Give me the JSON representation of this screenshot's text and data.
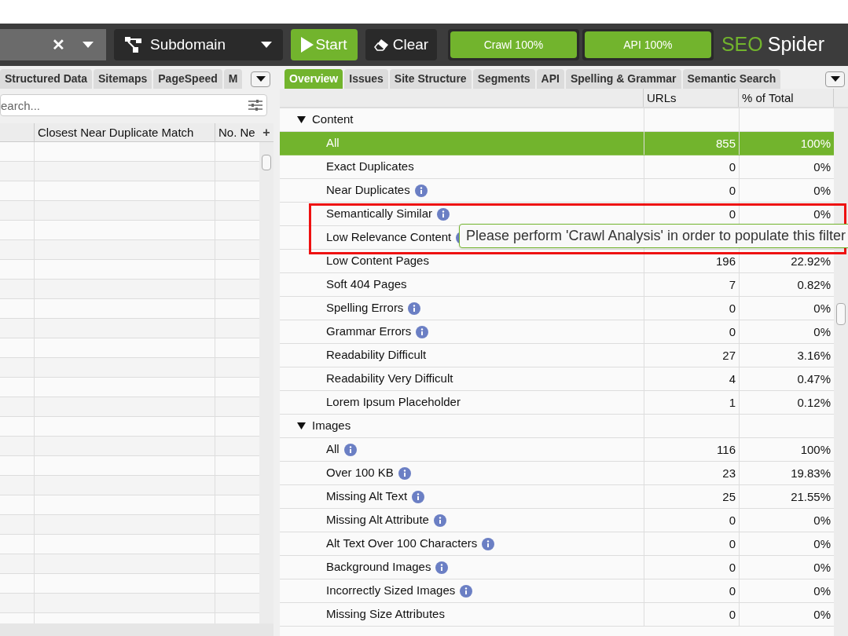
{
  "toolbar": {
    "url_field": {
      "clear": "✕"
    },
    "mode": {
      "label": "Subdomain"
    },
    "start": "Start",
    "clear": "Clear",
    "progress": [
      {
        "label": "Crawl 100%",
        "level": 1
      },
      {
        "label": "API 100%",
        "level": 1
      }
    ],
    "logo": {
      "first": "SEO",
      "second": "Spider"
    }
  },
  "left": {
    "tabs": [
      {
        "label": "Structured Data",
        "selected": false
      },
      {
        "label": "Sitemaps",
        "selected": false
      },
      {
        "label": "PageSpeed",
        "selected": false
      },
      {
        "label": "M",
        "selected": false
      }
    ],
    "search": {
      "placeholder": "earch..."
    },
    "columns": [
      "Closest Near Duplicate Match",
      "No. Ne"
    ],
    "add_column": "+"
  },
  "right": {
    "tabs": [
      {
        "label": "Overview",
        "selected": true
      },
      {
        "label": "Issues",
        "selected": false
      },
      {
        "label": "Site Structure",
        "selected": false
      },
      {
        "label": "Segments",
        "selected": false
      },
      {
        "label": "API",
        "selected": false
      },
      {
        "label": "Spelling & Grammar",
        "selected": false
      },
      {
        "label": "Semantic Search",
        "selected": false
      }
    ],
    "columns": [
      "URLs",
      "% of Total"
    ],
    "sections": [
      {
        "label": "Content",
        "expanded": true,
        "children": [
          {
            "label": "All",
            "info": false,
            "urls": "855",
            "percent": "100%",
            "selected": true
          },
          {
            "label": "Exact Duplicates",
            "info": false,
            "urls": "0",
            "percent": "0%",
            "selected": false
          },
          {
            "label": "Near Duplicates",
            "info": true,
            "urls": "0",
            "percent": "0%",
            "selected": false
          },
          {
            "label": "Semantically Similar",
            "info": true,
            "urls": "0",
            "percent": "0%",
            "selected": false
          },
          {
            "label": "Low Relevance Content",
            "info": true,
            "selected": false
          },
          {
            "label": "Low Content Pages",
            "info": false,
            "urls": "196",
            "percent": "22.92%",
            "selected": false
          },
          {
            "label": "Soft 404 Pages",
            "info": false,
            "urls": "7",
            "percent": "0.82%",
            "selected": false
          },
          {
            "label": "Spelling Errors",
            "info": true,
            "urls": "0",
            "percent": "0%",
            "selected": false
          },
          {
            "label": "Grammar Errors",
            "info": true,
            "urls": "0",
            "percent": "0%",
            "selected": false
          },
          {
            "label": "Readability Difficult",
            "info": false,
            "urls": "27",
            "percent": "3.16%",
            "selected": false
          },
          {
            "label": "Readability Very Difficult",
            "info": false,
            "urls": "4",
            "percent": "0.47%",
            "selected": false
          },
          {
            "label": "Lorem Ipsum Placeholder",
            "info": false,
            "urls": "1",
            "percent": "0.12%",
            "selected": false
          }
        ]
      },
      {
        "label": "Images",
        "expanded": true,
        "children": [
          {
            "label": "All",
            "info": true,
            "urls": "116",
            "percent": "100%",
            "selected": false
          },
          {
            "label": "Over 100 KB",
            "info": true,
            "urls": "23",
            "percent": "19.83%",
            "selected": false
          },
          {
            "label": "Missing Alt Text",
            "info": true,
            "urls": "25",
            "percent": "21.55%",
            "selected": false
          },
          {
            "label": "Missing Alt Attribute",
            "info": true,
            "urls": "0",
            "percent": "0%",
            "selected": false
          },
          {
            "label": "Alt Text Over 100 Characters",
            "info": true,
            "urls": "0",
            "percent": "0%",
            "selected": false
          },
          {
            "label": "Background Images",
            "info": true,
            "urls": "0",
            "percent": "0%",
            "selected": false
          },
          {
            "label": "Incorrectly Sized Images",
            "info": true,
            "urls": "0",
            "percent": "0%",
            "selected": false
          },
          {
            "label": "Missing Size Attributes",
            "info": false,
            "urls": "0",
            "percent": "0%",
            "selected": false
          }
        ]
      }
    ],
    "tooltip": "Please perform 'Crawl Analysis' in order to populate this filter"
  }
}
